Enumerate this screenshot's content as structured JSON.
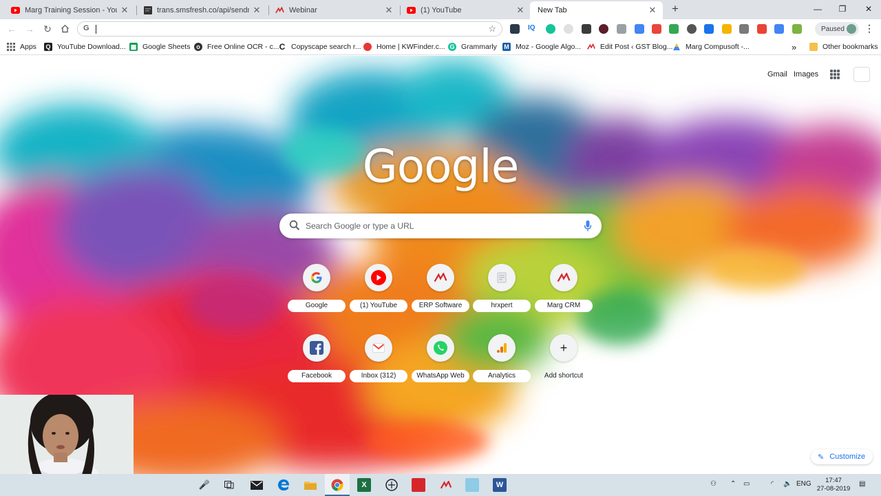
{
  "tabs": [
    {
      "title": "Marg Training Session - YouTube",
      "icon": "youtube-icon",
      "active": false
    },
    {
      "title": "trans.smsfresh.co/api/sendmsg.p",
      "icon": "page-icon",
      "active": false
    },
    {
      "title": "Webinar",
      "icon": "marg-icon",
      "active": false
    },
    {
      "title": "(1) YouTube",
      "icon": "youtube-icon",
      "active": false
    },
    {
      "title": "New Tab",
      "icon": "",
      "active": true
    }
  ],
  "toolbar": {
    "omnibox_value": "",
    "omnibox_prefix": "G",
    "profile_status": "Paused"
  },
  "bookmarks": [
    {
      "label": "Apps",
      "icon": "apps-grid-icon"
    },
    {
      "label": "YouTube Download...",
      "icon": "youtube-download-icon"
    },
    {
      "label": "Google Sheets",
      "icon": "google-sheets-icon"
    },
    {
      "label": "Free Online OCR - c...",
      "icon": "ocr-icon"
    },
    {
      "label": "Copyscape search r...",
      "icon": "copyscape-icon"
    },
    {
      "label": "Home | KWFinder.c...",
      "icon": "kwfinder-icon"
    },
    {
      "label": "Grammarly",
      "icon": "grammarly-icon"
    },
    {
      "label": "Moz - Google Algo...",
      "icon": "moz-icon"
    },
    {
      "label": "Edit Post ‹ GST Blog...",
      "icon": "marg-icon"
    },
    {
      "label": "Marg Compusoft -...",
      "icon": "marg-compusoft-icon"
    }
  ],
  "bookmarks_overflow": "»",
  "other_bookmarks": "Other bookmarks",
  "page": {
    "gmail": "Gmail",
    "images": "Images",
    "logo": "Google",
    "search_placeholder": "Search Google or type a URL",
    "customize": "Customize"
  },
  "shortcuts": [
    {
      "label": "Google",
      "icon": "google-g-icon"
    },
    {
      "label": "(1) YouTube",
      "icon": "youtube-icon"
    },
    {
      "label": "ERP Software",
      "icon": "marg-icon"
    },
    {
      "label": "hrxpert",
      "icon": "hrxpert-icon"
    },
    {
      "label": "Marg CRM",
      "icon": "marg-icon"
    },
    {
      "label": "Facebook",
      "icon": "facebook-icon"
    },
    {
      "label": "Inbox (312)",
      "icon": "gmail-icon"
    },
    {
      "label": "WhatsApp Web",
      "icon": "whatsapp-icon"
    },
    {
      "label": "Analytics",
      "icon": "analytics-icon"
    },
    {
      "label": "Add shortcut",
      "icon": "plus-icon"
    }
  ],
  "taskbar": {
    "language": "ENG",
    "time": "17:47",
    "date": "27-08-2019"
  },
  "colors": {
    "tab_strip": "#dee1e6",
    "taskbar": "#d7e1e8",
    "link_blue": "#1a73e8"
  }
}
